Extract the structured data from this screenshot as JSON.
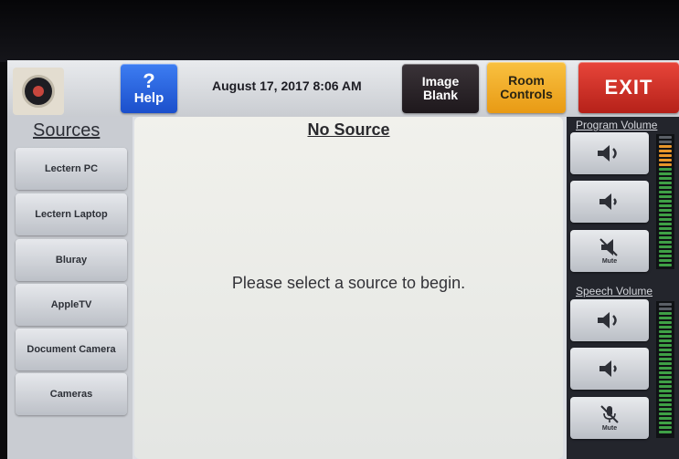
{
  "header": {
    "help_symbol": "?",
    "help_label": "Help",
    "datetime": "August 17, 2017 8:06 AM",
    "image_blank_line1": "Image",
    "image_blank_line2": "Blank",
    "room_controls_line1": "Room",
    "room_controls_line2": "Controls",
    "exit_label": "EXIT"
  },
  "sources": {
    "title": "Sources",
    "items": [
      {
        "label": "Lectern PC"
      },
      {
        "label": "Lectern Laptop"
      },
      {
        "label": "Bluray"
      },
      {
        "label": "AppleTV"
      },
      {
        "label": "Document Camera"
      },
      {
        "label": "Cameras"
      }
    ]
  },
  "main": {
    "title": "No Source",
    "message": "Please select a source to begin."
  },
  "program_volume": {
    "title": "Program Volume",
    "mute_label": "Mute"
  },
  "speech_volume": {
    "title": "Speech Volume",
    "mute_label": "Mute"
  },
  "colors": {
    "help": "#2759e0",
    "image_blank": "#2b2428",
    "room_controls": "#f3ad27",
    "exit": "#cf3228",
    "meter_green": "#3fa046",
    "meter_orange": "#e8962a"
  },
  "icons": {
    "seal": "institution-seal-icon",
    "volume_up": "speaker-up-icon",
    "volume_down": "speaker-down-icon",
    "program_mute": "speaker-mute-icon",
    "speech_mute": "microphone-mute-icon"
  }
}
